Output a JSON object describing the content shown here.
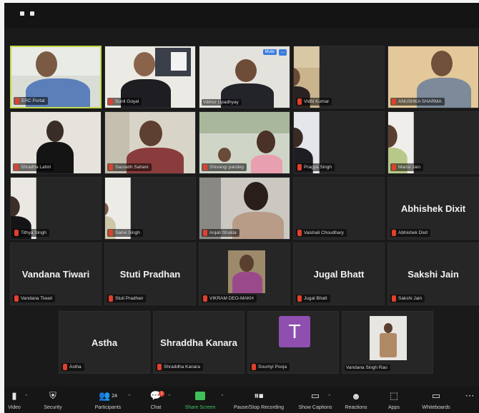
{
  "participants": [
    {
      "name": "ERC Portal",
      "big": ""
    },
    {
      "name": "Sunil Goyal",
      "big": ""
    },
    {
      "name": "Vibhor Upadhyay",
      "big": ""
    },
    {
      "name": "Vidhi Kumar",
      "big": ""
    },
    {
      "name": "ANUSHKA SHARMA",
      "big": ""
    },
    {
      "name": "Shradha Lahiri",
      "big": ""
    },
    {
      "name": "Saurabh Sahani",
      "big": ""
    },
    {
      "name": "Shivangi pandey",
      "big": ""
    },
    {
      "name": "Pragya Singh",
      "big": ""
    },
    {
      "name": "Mansi Jain",
      "big": ""
    },
    {
      "name": "Tithya Singh",
      "big": ""
    },
    {
      "name": "Sanvi Singh",
      "big": ""
    },
    {
      "name": "Anjali Shukla",
      "big": ""
    },
    {
      "name": "Vaishali Choudhary",
      "big": ""
    },
    {
      "name": "Abhishek Dixit",
      "big": "Abhishek Dixit"
    },
    {
      "name": "Vandana Tiwari",
      "big": "Vandana Tiwari"
    },
    {
      "name": "Stuti Pradhan",
      "big": "Stuti Pradhan"
    },
    {
      "name": "VIKRAM DEO-MAKH",
      "big": ""
    },
    {
      "name": "Jugal Bhatt",
      "big": "Jugal Bhatt"
    },
    {
      "name": "Sakshi Jain",
      "big": "Sakshi Jain"
    },
    {
      "name": "Astha",
      "big": "Astha"
    },
    {
      "name": "Shraddha Kanara",
      "big": "Shraddha Kanara"
    },
    {
      "name": "Soumyi Pooja",
      "big": ""
    },
    {
      "name": "Vandana Singh Rao",
      "big": ""
    }
  ],
  "tile_buttons": {
    "mute": "Mute",
    "more": "..."
  },
  "avatar_letter": "T",
  "toolbar": {
    "video": "Video",
    "security": "Security",
    "participants": "Participants",
    "participants_count": "24",
    "chat": "Chat",
    "chat_badge": "2",
    "share_screen": "Share Screen",
    "record": "Pause/Stop Recording",
    "captions": "Show Captions",
    "reactions": "Reactions",
    "apps": "Apps",
    "whiteboards": "Whiteboards",
    "more": "⋯"
  },
  "colors": {
    "accent_green": "#3fc05a",
    "mute_red": "#e0402c",
    "active_border": "#c4d94a",
    "avatar_purple": "#8e4fb0"
  }
}
